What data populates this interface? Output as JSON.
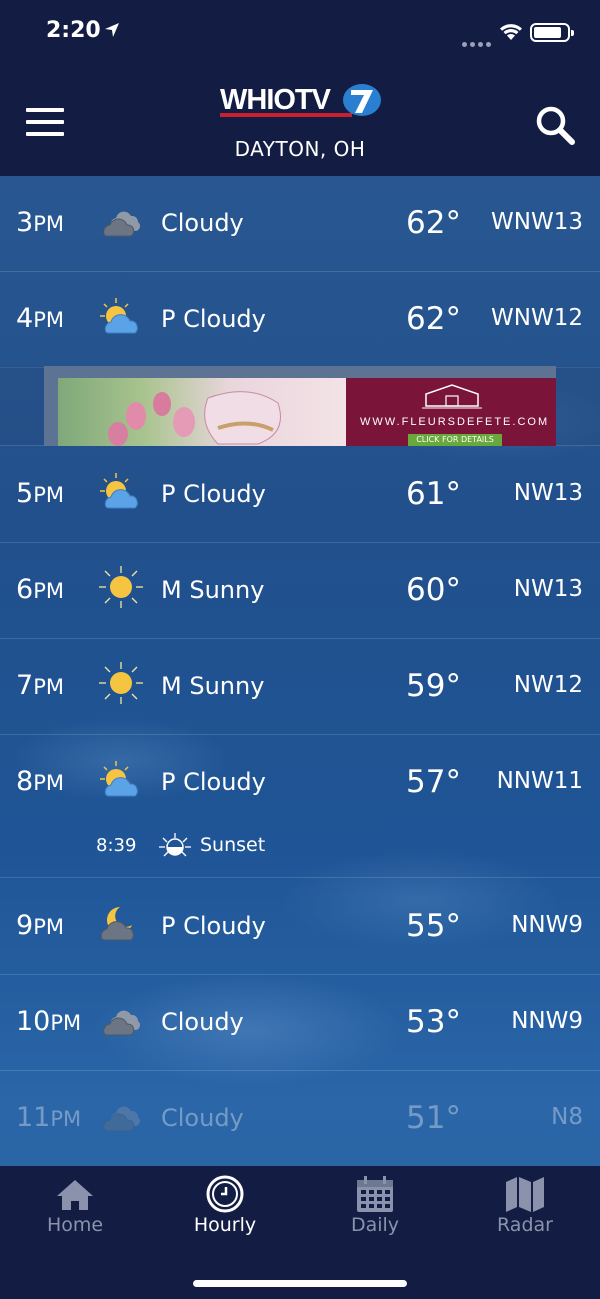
{
  "status_bar": {
    "time": "2:20"
  },
  "header": {
    "logo_text": "WHIOTV",
    "city": "DAYTON, OH"
  },
  "hourly": [
    {
      "hour": "3",
      "ampm": "PM",
      "icon": "cloudy-icon",
      "condition": "Cloudy",
      "temp": "62°",
      "wind": "WNW13"
    },
    {
      "hour": "4",
      "ampm": "PM",
      "icon": "partly-cloudy-icon",
      "condition": "P Cloudy",
      "temp": "62°",
      "wind": "WNW12"
    },
    {
      "hour": "5",
      "ampm": "PM",
      "icon": "partly-cloudy-icon",
      "condition": "P Cloudy",
      "temp": "61°",
      "wind": "NW13"
    },
    {
      "hour": "6",
      "ampm": "PM",
      "icon": "sunny-icon",
      "condition": "M Sunny",
      "temp": "60°",
      "wind": "NW13"
    },
    {
      "hour": "7",
      "ampm": "PM",
      "icon": "sunny-icon",
      "condition": "M Sunny",
      "temp": "59°",
      "wind": "NW12"
    },
    {
      "hour": "8",
      "ampm": "PM",
      "icon": "partly-cloudy-icon",
      "condition": "P Cloudy",
      "temp": "57°",
      "wind": "NNW11"
    },
    {
      "hour": "9",
      "ampm": "PM",
      "icon": "partly-cloudy-night-icon",
      "condition": "P Cloudy",
      "temp": "55°",
      "wind": "NNW9"
    },
    {
      "hour": "10",
      "ampm": "PM",
      "icon": "cloudy-icon",
      "condition": "Cloudy",
      "temp": "53°",
      "wind": "NNW9"
    },
    {
      "hour": "11",
      "ampm": "PM",
      "icon": "cloudy-icon",
      "condition": "Cloudy",
      "temp": "51°",
      "wind": "N8"
    }
  ],
  "sunset": {
    "time": "8:39",
    "label": "Sunset"
  },
  "ad": {
    "url": "WWW.FLEURSDEFETE.COM",
    "cta": "CLICK FOR DETAILS"
  },
  "tabs": [
    {
      "label": "Home",
      "icon": "home-icon",
      "active": false
    },
    {
      "label": "Hourly",
      "icon": "clock-icon",
      "active": true
    },
    {
      "label": "Daily",
      "icon": "calendar-icon",
      "active": false
    },
    {
      "label": "Radar",
      "icon": "map-icon",
      "active": false
    }
  ],
  "colors": {
    "header_bg": "#131c42",
    "logo_red": "#c8202e",
    "logo_blue": "#2a7fd0",
    "sun_yellow": "#f5c542",
    "cloud_blue": "#5ba3e6",
    "tab_inactive": "#8a93ab"
  }
}
